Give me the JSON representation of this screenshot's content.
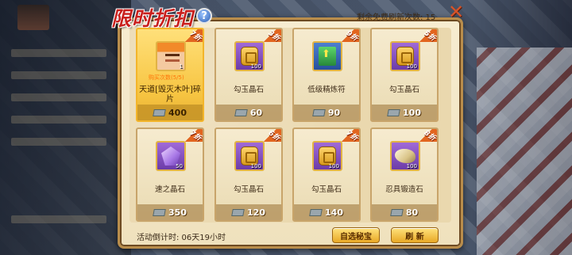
{
  "title": "限时折扣",
  "refresh_label": "剩余免费刷新次数: 15",
  "countdown_label": "活动倒计时: 06天19小时",
  "buttons": {
    "custom": "自选秘宝",
    "refresh": "刷 新"
  },
  "items": [
    {
      "name": "天道[毁灭木叶]碎片",
      "price": "400",
      "qty": "1",
      "buy_info": "购买次数(5/5)",
      "discount": "7折",
      "icon": "character-portrait-icon",
      "selected": true
    },
    {
      "name": "勾玉晶石",
      "price": "60",
      "qty": "100",
      "discount": "3折",
      "icon": "jade-icon"
    },
    {
      "name": "低级精炼符",
      "price": "90",
      "qty": "",
      "discount": "9折",
      "icon": "refine-scroll-icon"
    },
    {
      "name": "勾玉晶石",
      "price": "100",
      "qty": "100",
      "discount": "5折",
      "icon": "jade-icon"
    },
    {
      "name": "速之晶石",
      "price": "350",
      "qty": "50",
      "discount": "7折",
      "icon": "speed-crystal-icon"
    },
    {
      "name": "勾玉晶石",
      "price": "120",
      "qty": "100",
      "discount": "6折",
      "icon": "jade-icon"
    },
    {
      "name": "勾玉晶石",
      "price": "140",
      "qty": "100",
      "discount": "7折",
      "icon": "jade-icon"
    },
    {
      "name": "忍具锻造石",
      "price": "80",
      "qty": "100",
      "discount": "8折",
      "icon": "forge-stone-icon"
    }
  ],
  "colors": {
    "title": "#c9201d",
    "selected_card": "#f7c542",
    "ribbon": "#e2651f"
  }
}
